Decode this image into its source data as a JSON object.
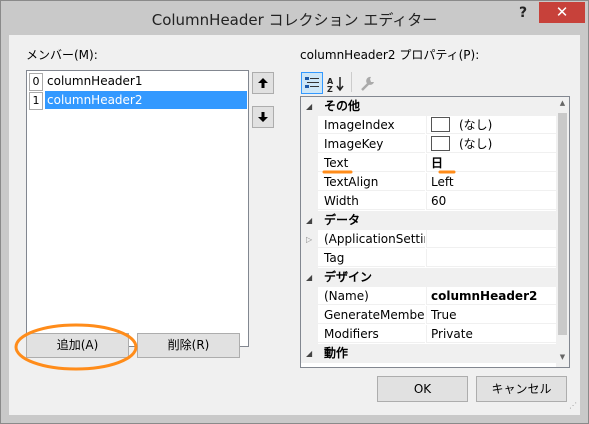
{
  "window": {
    "title": "ColumnHeader コレクション エディター",
    "help": "?",
    "close": "✕"
  },
  "members": {
    "label": "メンバー(M):",
    "items": [
      {
        "index": "0",
        "name": "columnHeader1"
      },
      {
        "index": "1",
        "name": "columnHeader2"
      }
    ]
  },
  "properties_label": "columnHeader2 プロパティ(P):",
  "grid": {
    "categories": [
      {
        "name": "その他",
        "rows": [
          {
            "name": "ImageIndex",
            "value": "(なし)"
          },
          {
            "name": "ImageKey",
            "value": "(なし)"
          },
          {
            "name": "Text",
            "value": "日"
          },
          {
            "name": "TextAlign",
            "value": "Left"
          },
          {
            "name": "Width",
            "value": "60"
          }
        ]
      },
      {
        "name": "データ",
        "rows": [
          {
            "name": "(ApplicationSettin",
            "value": ""
          },
          {
            "name": "Tag",
            "value": ""
          }
        ]
      },
      {
        "name": "デザイン",
        "rows": [
          {
            "name": "(Name)",
            "value": "columnHeader2"
          },
          {
            "name": "GenerateMember",
            "value": "True"
          },
          {
            "name": "Modifiers",
            "value": "Private"
          }
        ]
      },
      {
        "name": "動作",
        "rows": []
      }
    ]
  },
  "buttons": {
    "add": "追加(A)",
    "remove": "削除(R)",
    "ok": "OK",
    "cancel": "キャンセル"
  },
  "colors": {
    "highlight": "#3399ff",
    "annotation": "#ff8c1a",
    "close": "#c7413a"
  }
}
